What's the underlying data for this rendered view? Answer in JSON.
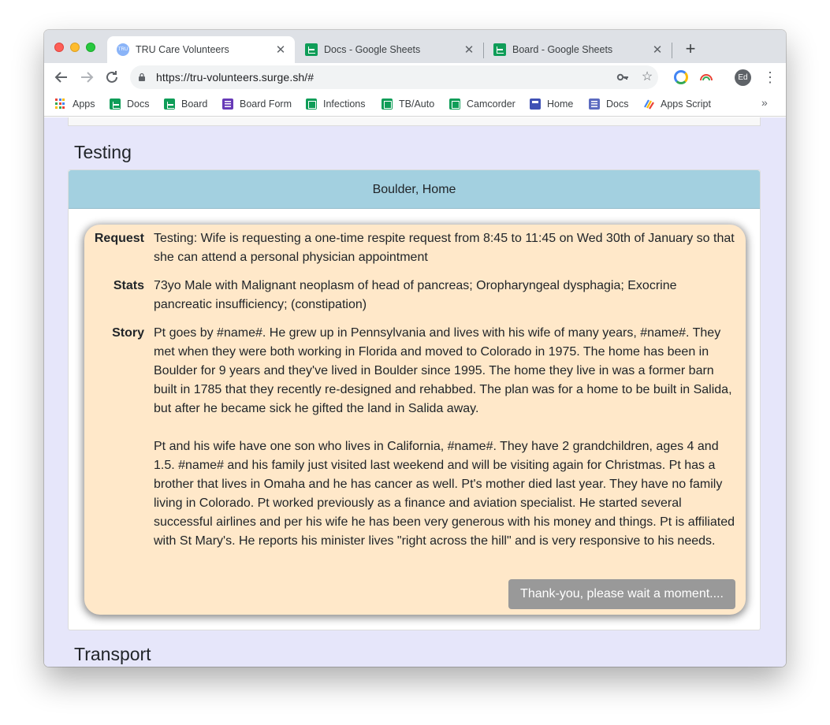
{
  "browser": {
    "tabs": [
      {
        "title": "TRU Care Volunteers",
        "icon": "tru-favicon-icon",
        "active": true
      },
      {
        "title": "Docs - Google Sheets",
        "icon": "google-sheets-icon",
        "active": false
      },
      {
        "title": "Board - Google Sheets",
        "icon": "google-sheets-icon",
        "active": false
      }
    ],
    "favicon_text": "TRU",
    "url": "https://tru-volunteers.surge.sh/#",
    "profile_initials": "Ed",
    "bookmarks": [
      {
        "label": "Apps",
        "icon": "apps-grid-icon"
      },
      {
        "label": "Docs",
        "icon": "google-sheets-icon"
      },
      {
        "label": "Board",
        "icon": "google-sheets-icon"
      },
      {
        "label": "Board Form",
        "icon": "google-forms-icon"
      },
      {
        "label": "Infections",
        "icon": "google-sheets-icon"
      },
      {
        "label": "TB/Auto",
        "icon": "google-sheets-icon"
      },
      {
        "label": "Camcorder",
        "icon": "google-sheets-icon"
      },
      {
        "label": "Home",
        "icon": "google-sites-icon"
      },
      {
        "label": "Docs",
        "icon": "google-forms-icon"
      },
      {
        "label": "Apps Script",
        "icon": "apps-script-icon"
      }
    ],
    "more_bookmarks": "»"
  },
  "page": {
    "section_title": "Testing",
    "next_section_title": "Transport",
    "card": {
      "location": "Boulder, Home",
      "rows": [
        {
          "label": "Request",
          "text": "Testing: Wife is requesting a one-time respite request from 8:45 to 11:45 on Wed 30th of January so that she can attend a personal physician appointment"
        },
        {
          "label": "Stats",
          "text": "73yo Male with Malignant neoplasm of head of pancreas; Oropharyngeal dysphagia; Exocrine pancreatic insufficiency; (constipation)"
        },
        {
          "label": "Story",
          "text": "Pt goes by #name#. He grew up in Pennsylvania and lives with his wife of many years, #name#. They met when they were both working in Florida and moved to Colorado in 1975. The home has been in Boulder for 9 years and they've lived in Boulder since 1995. The home they live in was a former barn built in 1785 that they recently re-designed and rehabbed. The plan was for a home to be built in Salida, but after he became sick he gifted the land in Salida away.\n\nPt and his wife have one son who lives in California, #name#. They have 2 grandchildren, ages 4 and 1.5. #name# and his family just visited last weekend and will be visiting again for Christmas. Pt has a brother that lives in Omaha and he has cancer as well. Pt's mother died last year. They have no family living in Colorado. Pt worked previously as a finance and aviation specialist. He started several successful airlines and per his wife he has been very generous with his money and things. Pt is affiliated with St Mary's. He reports his minister lives \"right across the hill\" and is very responsive to his needs."
        }
      ],
      "button_label": "Thank-you, please wait a moment...."
    }
  },
  "colors": {
    "page_bg": "#e6e6fa",
    "card_header_bg": "#a3d0e0",
    "request_box_bg": "#ffe8c9",
    "wait_button_bg": "#999999"
  }
}
